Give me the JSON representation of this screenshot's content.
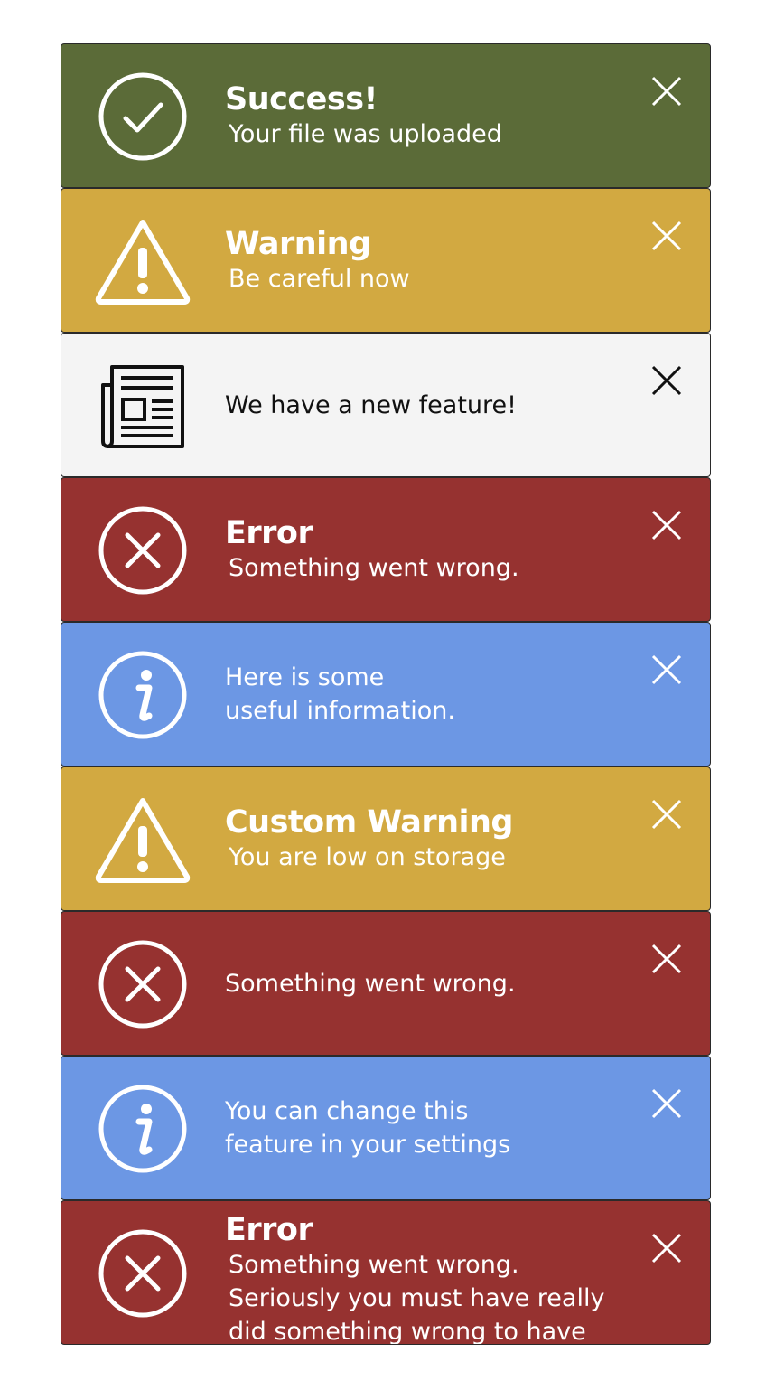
{
  "toasts": [
    {
      "variant": "success",
      "icon": "check-circle-icon",
      "title": "Success!",
      "message": "Your file was uploaded"
    },
    {
      "variant": "warning",
      "icon": "warning-triangle-icon",
      "title": "Warning",
      "message": "Be careful now"
    },
    {
      "variant": "neutral",
      "icon": "newspaper-icon",
      "title": "",
      "message": "We have a new feature!"
    },
    {
      "variant": "error",
      "icon": "x-circle-icon",
      "title": "Error",
      "message": "Something went wrong."
    },
    {
      "variant": "info",
      "icon": "info-circle-icon",
      "title": "",
      "message": "Here is some\nuseful information."
    },
    {
      "variant": "warning",
      "icon": "warning-triangle-icon",
      "title": "Custom Warning",
      "message": "You are low on storage"
    },
    {
      "variant": "error",
      "icon": "x-circle-icon",
      "title": "",
      "message": "Something went wrong."
    },
    {
      "variant": "info",
      "icon": "info-circle-icon",
      "title": "",
      "message": "You can change this\nfeature in your settings"
    },
    {
      "variant": "error",
      "icon": "x-circle-icon",
      "title": "Error",
      "message": "Something went wrong.\nSeriously you must have really\ndid something wrong to have"
    }
  ],
  "colors": {
    "success": "#5b6b38",
    "warning": "#d2a941",
    "neutral": "#f4f4f4",
    "error": "#963230",
    "info": "#6c97e4"
  }
}
